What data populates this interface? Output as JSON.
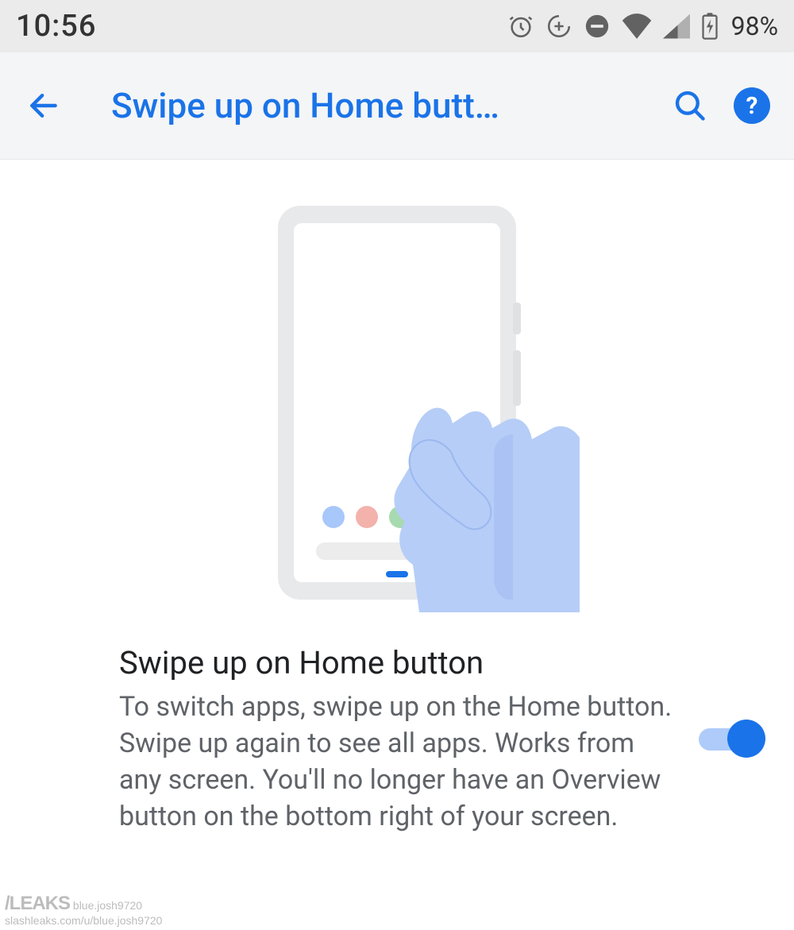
{
  "status": {
    "time": "10:56",
    "battery_pct": "98%"
  },
  "appbar": {
    "title": "Swipe up on Home butt…"
  },
  "setting": {
    "title": "Swipe up on Home button",
    "description": "To switch apps, swipe up on the Home button. Swipe up again to see all apps. Works from any screen. You'll no longer have an Overview button on the bottom right of your screen.",
    "toggle_on": true
  },
  "watermark": {
    "brand": "/LEAKS",
    "line1": "blue.josh9720",
    "line2": "slashleaks.com/u/blue.josh9720"
  },
  "colors": {
    "accent": "#1a73e8"
  }
}
